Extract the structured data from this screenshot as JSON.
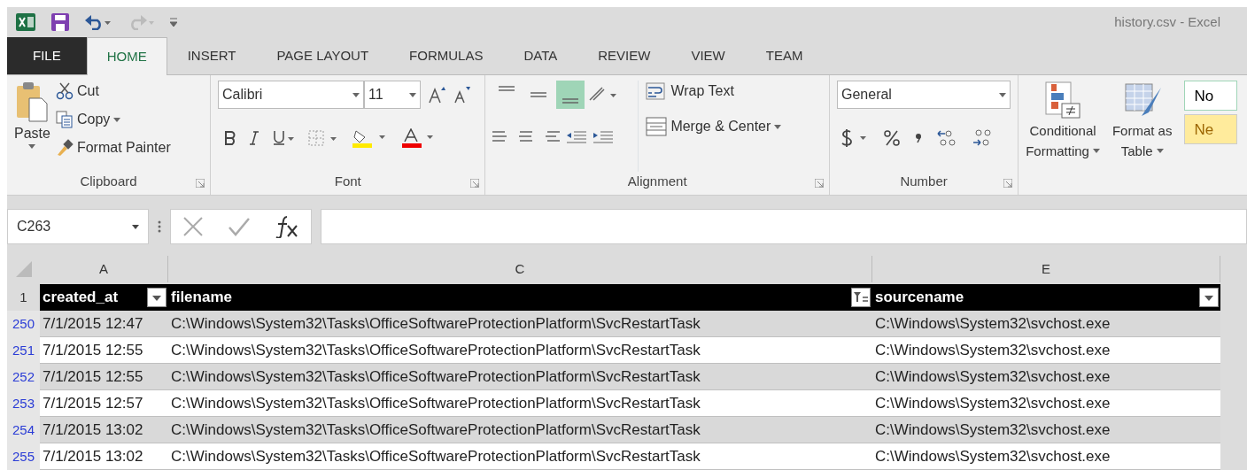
{
  "window": {
    "title": "history.csv - Excel"
  },
  "tabs": [
    {
      "label": "FILE",
      "kind": "file",
      "selected": false
    },
    {
      "label": "HOME",
      "kind": "tab",
      "selected": true
    },
    {
      "label": "INSERT",
      "kind": "tab",
      "selected": false
    },
    {
      "label": "PAGE LAYOUT",
      "kind": "tab",
      "selected": false
    },
    {
      "label": "FORMULAS",
      "kind": "tab",
      "selected": false
    },
    {
      "label": "DATA",
      "kind": "tab",
      "selected": false
    },
    {
      "label": "REVIEW",
      "kind": "tab",
      "selected": false
    },
    {
      "label": "VIEW",
      "kind": "tab",
      "selected": false
    },
    {
      "label": "TEAM",
      "kind": "tab",
      "selected": false
    }
  ],
  "ribbon": {
    "clipboard": {
      "paste": "Paste",
      "cut": "Cut",
      "copy": "Copy",
      "format_painter": "Format Painter",
      "label": "Clipboard"
    },
    "font": {
      "font_name": "Calibri",
      "font_size": "11",
      "label": "Font"
    },
    "alignment": {
      "vertical": [
        {
          "selected": false
        },
        {
          "selected": false
        },
        {
          "selected": true
        }
      ],
      "wrap_text": "Wrap Text",
      "merge": "Merge & Center",
      "label": "Alignment"
    },
    "number": {
      "format": "General",
      "label": "Number"
    },
    "styles": {
      "conditional": [
        "Conditional",
        "Formatting"
      ],
      "format_table": [
        "Format as",
        "Table"
      ],
      "cells": [
        {
          "text": "No",
          "color": "#ffffff"
        },
        {
          "text": "Ne",
          "color": "#ffeb9c"
        }
      ]
    }
  },
  "formula_bar": {
    "name_box": "C263"
  },
  "sheet": {
    "columns": [
      "A",
      "C",
      "E"
    ],
    "header_row": "1",
    "headers": [
      {
        "text": "created_at",
        "kind": "dropdown"
      },
      {
        "text": "filename",
        "kind": "filtered"
      },
      {
        "text": "sourcename",
        "kind": "dropdown"
      }
    ],
    "rows": [
      {
        "number": "250",
        "cells": [
          "7/1/2015 12:47",
          "C:\\Windows\\System32\\Tasks\\OfficeSoftwareProtectionPlatform\\SvcRestartTask",
          "C:\\Windows\\System32\\svchost.exe"
        ]
      },
      {
        "number": "251",
        "cells": [
          "7/1/2015 12:55",
          "C:\\Windows\\System32\\Tasks\\OfficeSoftwareProtectionPlatform\\SvcRestartTask",
          "C:\\Windows\\System32\\svchost.exe"
        ]
      },
      {
        "number": "252",
        "cells": [
          "7/1/2015 12:55",
          "C:\\Windows\\System32\\Tasks\\OfficeSoftwareProtectionPlatform\\SvcRestartTask",
          "C:\\Windows\\System32\\svchost.exe"
        ]
      },
      {
        "number": "253",
        "cells": [
          "7/1/2015 12:57",
          "C:\\Windows\\System32\\Tasks\\OfficeSoftwareProtectionPlatform\\SvcRestartTask",
          "C:\\Windows\\System32\\svchost.exe"
        ]
      },
      {
        "number": "254",
        "cells": [
          "7/1/2015 13:02",
          "C:\\Windows\\System32\\Tasks\\OfficeSoftwareProtectionPlatform\\SvcRestartTask",
          "C:\\Windows\\System32\\svchost.exe"
        ]
      },
      {
        "number": "255",
        "cells": [
          "7/1/2015 13:02",
          "C:\\Windows\\System32\\Tasks\\OfficeSoftwareProtectionPlatform\\SvcRestartTask",
          "C:\\Windows\\System32\\svchost.exe"
        ]
      }
    ]
  }
}
